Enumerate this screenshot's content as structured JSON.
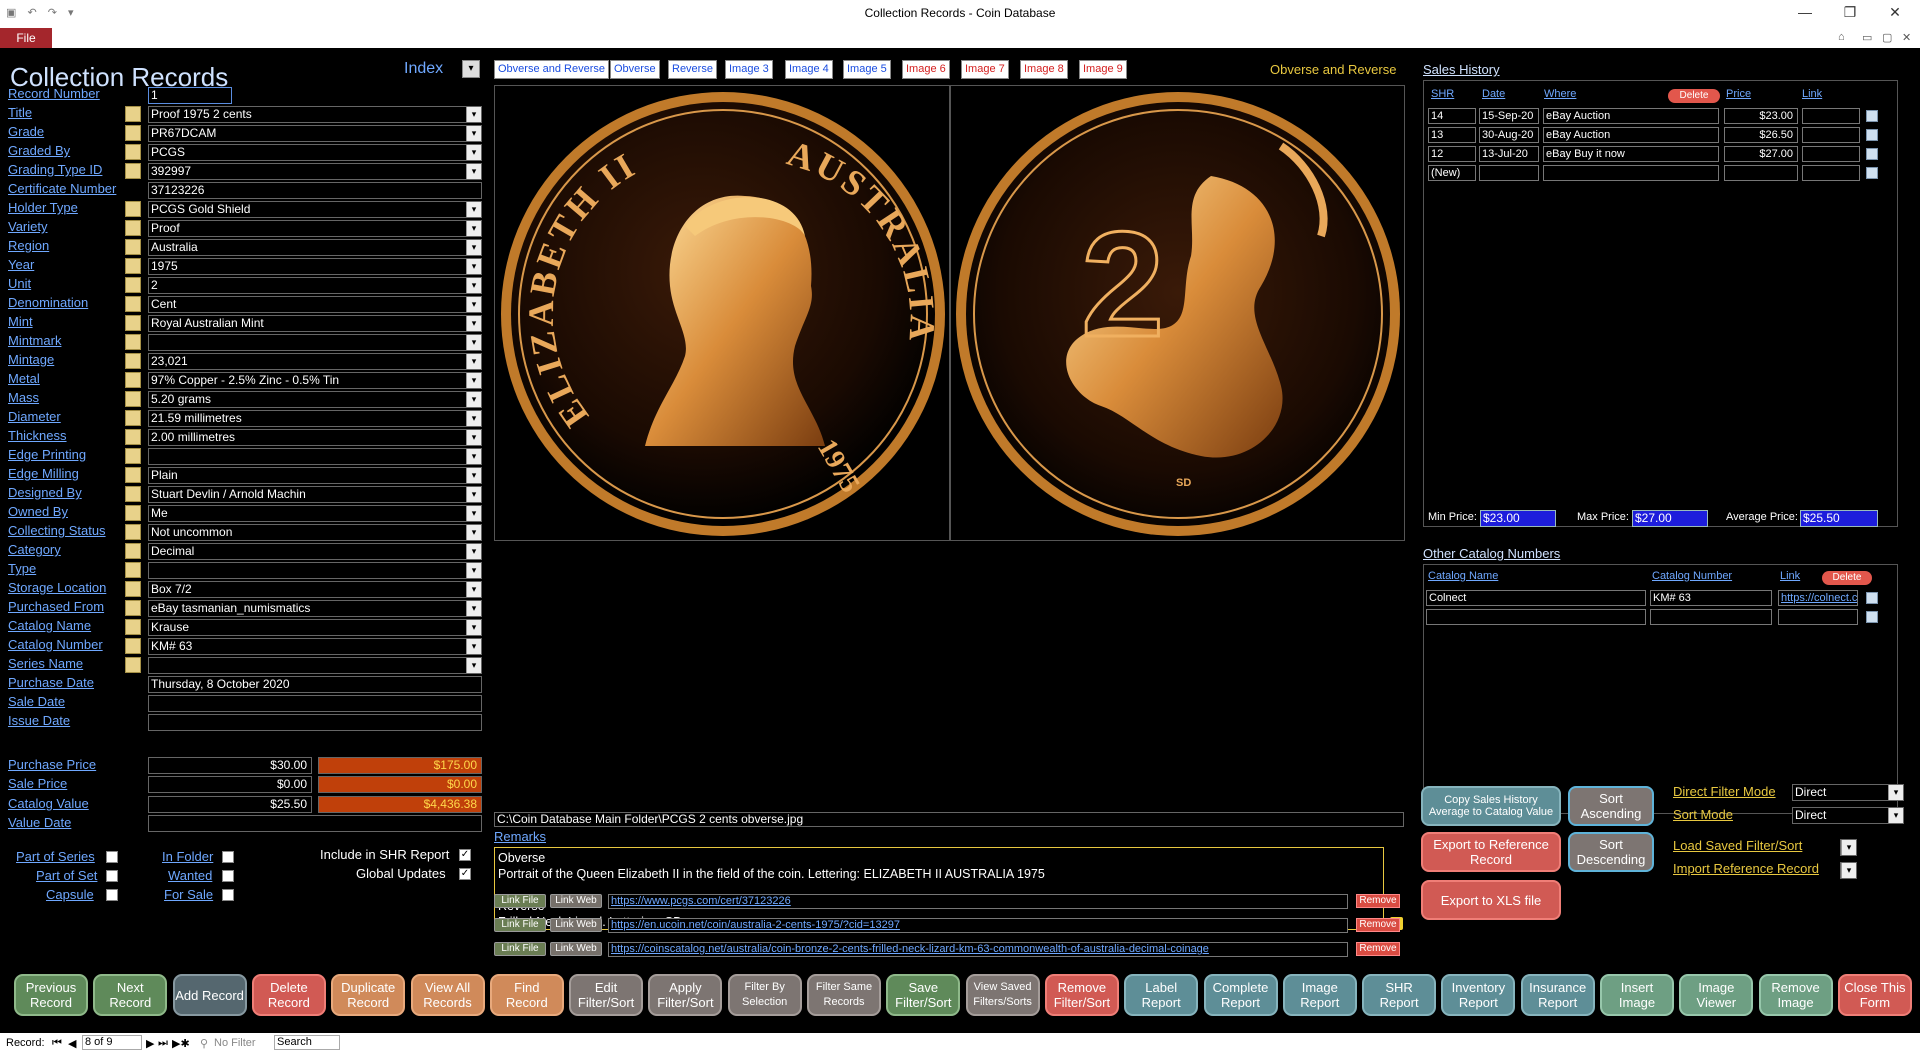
{
  "window": {
    "title": "Collection Records  -  Coin Database",
    "file_tab": "File"
  },
  "form": {
    "heading": "Collection Records",
    "index_label": "Index"
  },
  "fields": [
    {
      "label": "Record Number",
      "value": "1",
      "dropdown": false
    },
    {
      "label": "Title",
      "value": "Proof 1975 2 cents",
      "dropdown": true
    },
    {
      "label": "Grade",
      "value": "PR67DCAM",
      "dropdown": true
    },
    {
      "label": "Graded By",
      "value": "PCGS",
      "dropdown": true
    },
    {
      "label": "Grading Type ID",
      "value": "392997",
      "dropdown": true
    },
    {
      "label": "Certificate Number",
      "value": "37123226",
      "dropdown": false
    },
    {
      "label": "Holder Type",
      "value": "PCGS Gold Shield",
      "dropdown": true
    },
    {
      "label": "Variety",
      "value": "Proof",
      "dropdown": true
    },
    {
      "label": "Region",
      "value": "Australia",
      "dropdown": true
    },
    {
      "label": "Year",
      "value": "1975",
      "dropdown": true
    },
    {
      "label": "Unit",
      "value": "2",
      "dropdown": true
    },
    {
      "label": "Denomination",
      "value": "Cent",
      "dropdown": true
    },
    {
      "label": "Mint",
      "value": "Royal Australian Mint",
      "dropdown": true
    },
    {
      "label": "Mintmark",
      "value": "",
      "dropdown": true
    },
    {
      "label": "Mintage",
      "value": "23,021",
      "dropdown": true
    },
    {
      "label": "Metal",
      "value": "97% Copper - 2.5% Zinc - 0.5% Tin",
      "dropdown": true
    },
    {
      "label": "Mass",
      "value": "5.20 grams",
      "dropdown": true
    },
    {
      "label": "Diameter",
      "value": "21.59 millimetres",
      "dropdown": true
    },
    {
      "label": "Thickness",
      "value": "2.00 millimetres",
      "dropdown": true
    },
    {
      "label": "Edge Printing",
      "value": "",
      "dropdown": true
    },
    {
      "label": "Edge Milling",
      "value": "Plain",
      "dropdown": true
    },
    {
      "label": "Designed By",
      "value": "Stuart Devlin / Arnold Machin",
      "dropdown": true
    },
    {
      "label": "Owned By",
      "value": "Me",
      "dropdown": true
    },
    {
      "label": "Collecting Status",
      "value": "Not uncommon",
      "dropdown": true
    },
    {
      "label": "Category",
      "value": "Decimal",
      "dropdown": true
    },
    {
      "label": "Type",
      "value": "",
      "dropdown": true
    },
    {
      "label": "Storage Location",
      "value": "Box 7/2",
      "dropdown": true
    },
    {
      "label": "Purchased From",
      "value": "eBay tasmanian_numismatics",
      "dropdown": true
    },
    {
      "label": "Catalog Name",
      "value": "Krause",
      "dropdown": true
    },
    {
      "label": "Catalog Number",
      "value": "KM# 63",
      "dropdown": true
    },
    {
      "label": "Series Name",
      "value": "",
      "dropdown": true
    },
    {
      "label": "Purchase Date",
      "value": "Thursday, 8 October 2020",
      "dropdown": false
    },
    {
      "label": "Sale Date",
      "value": "",
      "dropdown": false
    },
    {
      "label": "Issue Date",
      "value": "",
      "dropdown": false
    }
  ],
  "money": [
    {
      "label": "Purchase Price",
      "value": "$30.00",
      "total": "$175.00"
    },
    {
      "label": "Sale Price",
      "value": "$0.00",
      "total": "$0.00"
    },
    {
      "label": "Catalog Value",
      "value": "$25.50",
      "total": "$4,436.38"
    },
    {
      "label": "Value Date",
      "value": "",
      "total": ""
    }
  ],
  "checks": {
    "part_of_series": "Part of Series",
    "part_of_set": "Part of Set",
    "capsule": "Capsule",
    "in_folder": "In Folder",
    "wanted": "Wanted",
    "for_sale": "For Sale",
    "include_shr": "Include in SHR Report",
    "global_updates": "Global Updates",
    "include_shr_checked": true,
    "global_updates_checked": true
  },
  "image_tabs": [
    {
      "label": "Obverse and Reverse",
      "color": "blue"
    },
    {
      "label": "Obverse",
      "color": "blue"
    },
    {
      "label": "Reverse",
      "color": "blue"
    },
    {
      "label": "Image 3",
      "color": "blue"
    },
    {
      "label": "Image 4",
      "color": "blue"
    },
    {
      "label": "Image 5",
      "color": "blue"
    },
    {
      "label": "Image 6",
      "color": "red"
    },
    {
      "label": "Image 7",
      "color": "red"
    },
    {
      "label": "Image 8",
      "color": "red"
    },
    {
      "label": "Image 9",
      "color": "red"
    }
  ],
  "image_view": {
    "mode_label": "Obverse and Reverse",
    "file_path": "C:\\Coin Database Main Folder\\PCGS 2 cents obverse.jpg",
    "obverse_text_left": "ELIZABETH II",
    "obverse_text_right": "AUSTRALIA",
    "obverse_year": "1975",
    "reverse_numeral": "2",
    "reverse_initials": "SD"
  },
  "remarks": {
    "label": "Remarks",
    "lines": [
      "Obverse",
      "Portrait of the Queen Elizabeth II in the field of the coin. Lettering: ELIZABETH II AUSTRALIA 1975",
      "",
      "Reverse",
      "Frilled-Neck Lizard. Lettering: SD"
    ]
  },
  "links": {
    "link_file": "Link File",
    "link_web": "Link Web",
    "remove": "Remove",
    "urls": [
      "https://www.pcgs.com/cert/37123226",
      "https://en.ucoin.net/coin/australia-2-cents-1975/?cid=13297",
      "https://coinscatalog.net/australia/coin-bronze-2-cents-frilled-neck-lizard-km-63-commonwealth-of-australia-decimal-coinage"
    ]
  },
  "sales_history": {
    "title": "Sales History",
    "headers": {
      "shr": "SHR",
      "date": "Date",
      "where": "Where",
      "delete": "Delete",
      "price": "Price",
      "link": "Link"
    },
    "rows": [
      {
        "shr": "14",
        "date": "15-Sep-20",
        "where": "eBay Auction",
        "price": "$23.00"
      },
      {
        "shr": "13",
        "date": "30-Aug-20",
        "where": "eBay Auction",
        "price": "$26.50"
      },
      {
        "shr": "12",
        "date": "13-Jul-20",
        "where": "eBay Buy it now",
        "price": "$27.00"
      },
      {
        "shr": "(New)",
        "date": "",
        "where": "",
        "price": ""
      }
    ],
    "min_label": "Min Price:",
    "min_value": "$23.00",
    "max_label": "Max Price:",
    "max_value": "$27.00",
    "avg_label": "Average Price:",
    "avg_value": "$25.50"
  },
  "other_catalog": {
    "title": "Other Catalog Numbers",
    "headers": {
      "name": "Catalog Name",
      "number": "Catalog Number",
      "link": "Link",
      "delete": "Delete"
    },
    "rows": [
      {
        "name": "Colnect",
        "number": "KM# 63",
        "link": "https://colnect.com"
      },
      {
        "name": "",
        "number": "",
        "link": ""
      }
    ]
  },
  "side_buttons": {
    "copy_sales": "Copy Sales History Average to Catalog Value",
    "sort_asc": "Sort Ascending",
    "export_ref": "Export to Reference Record",
    "sort_desc": "Sort Descending",
    "export_xls": "Export to XLS file"
  },
  "filter_options": {
    "direct_filter_label": "Direct Filter Mode",
    "direct_filter_value": "Direct",
    "sort_mode_label": "Sort Mode",
    "sort_mode_value": "Direct",
    "load_saved": "Load Saved Filter/Sort",
    "import_ref": "Import Reference Record"
  },
  "bottom_buttons": [
    {
      "label": "Previous Record",
      "style": "gr"
    },
    {
      "label": "Next Record",
      "style": "gr"
    },
    {
      "label": "Add Record",
      "style": "sl"
    },
    {
      "label": "Delete Record",
      "style": "rd"
    },
    {
      "label": "Duplicate Record",
      "style": "or"
    },
    {
      "label": "View All Records",
      "style": "or"
    },
    {
      "label": "Find Record",
      "style": "or"
    },
    {
      "label": "Edit Filter/Sort",
      "style": "gy"
    },
    {
      "label": "Apply Filter/Sort",
      "style": "gy"
    },
    {
      "label": "Filter By Selection",
      "style": "gy"
    },
    {
      "label": "Filter Same Records",
      "style": "gy"
    },
    {
      "label": "Save Filter/Sort",
      "style": "gr"
    },
    {
      "label": "View Saved Filters/Sorts",
      "style": "gy"
    },
    {
      "label": "Remove Filter/Sort",
      "style": "rd"
    },
    {
      "label": "Label Report",
      "style": "tl"
    },
    {
      "label": "Complete Report",
      "style": "tl"
    },
    {
      "label": "Image Report",
      "style": "tl"
    },
    {
      "label": "SHR Report",
      "style": "tl"
    },
    {
      "label": "Inventory Report",
      "style": "tl"
    },
    {
      "label": "Insurance Report",
      "style": "tl"
    },
    {
      "label": "Insert Image",
      "style": "mint"
    },
    {
      "label": "Image Viewer",
      "style": "mint"
    },
    {
      "label": "Remove Image",
      "style": "mint"
    },
    {
      "label": "Close This Form",
      "style": "rd"
    }
  ],
  "status_bar": {
    "record_label": "Record:",
    "position": "8 of 9",
    "no_filter": "No Filter",
    "search": "Search"
  }
}
